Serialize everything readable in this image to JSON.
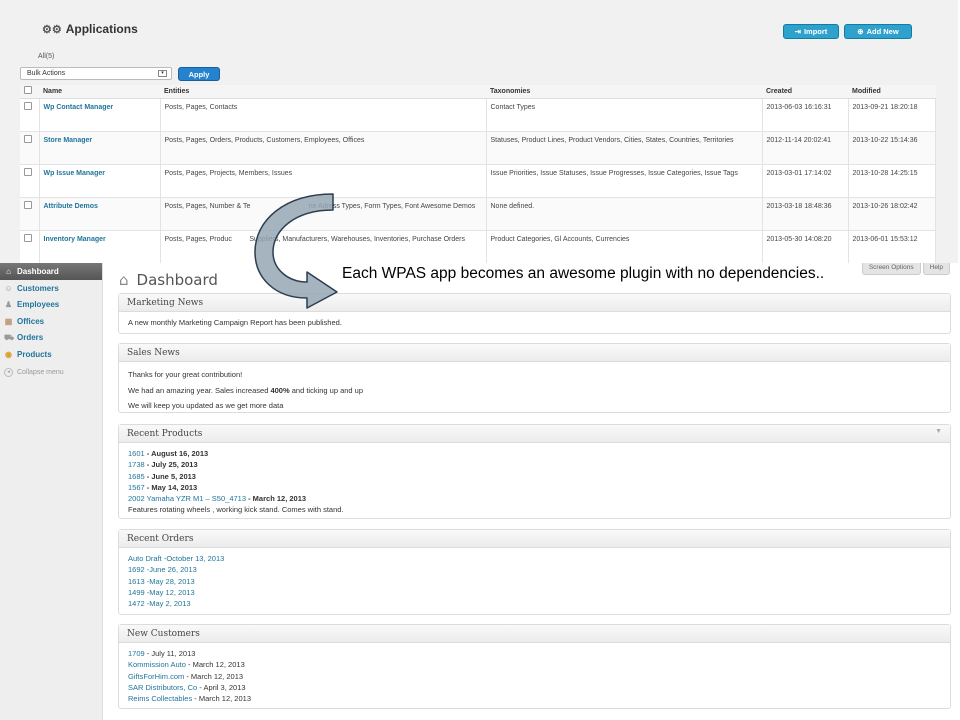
{
  "applications": {
    "title": "Applications",
    "import_label": "Import",
    "add_new_label": "Add New",
    "filter_all": "All(5)",
    "bulk_actions": "Bulk Actions",
    "apply_label": "Apply",
    "columns": [
      "Name",
      "Entities",
      "Taxonomies",
      "Created",
      "Modified"
    ],
    "rows": [
      {
        "name": "Wp Contact Manager",
        "entities": "Posts, Pages, Contacts",
        "taxonomies": "Contact Types",
        "created": "2013-06-03 16:16:31",
        "modified": "2013-09-21 18:20:18"
      },
      {
        "name": "Store Manager",
        "entities": "Posts, Pages, Orders, Products, Customers, Employees, Offices",
        "taxonomies": "Statuses, Product Lines, Product Vendors, Cities, States, Countries, Territories",
        "created": "2012-11-14 20:02:41",
        "modified": "2013-10-22 15:14:36"
      },
      {
        "name": "Wp Issue Manager",
        "entities": "Posts, Pages, Projects, Members, Issues",
        "taxonomies": "Issue Priorities, Issue Statuses, Issue Progresses, Issue Categories, Issue Tags",
        "created": "2013-03-01 17:14:02",
        "modified": "2013-10-28 14:25:15"
      },
      {
        "name": "Attribute Demos",
        "entities": "Posts, Pages, Number & Te                              ne Adress Types, Form Types, Font Awesome Demos",
        "taxonomies": "None defined.",
        "created": "2013-03-18 18:48:36",
        "modified": "2013-10-26 18:02:42"
      },
      {
        "name": "Inventory Manager",
        "entities": "Posts, Pages, Produc         Suppliers, Manufacturers, Warehouses, Inventories, Purchase Orders",
        "taxonomies": "Product Categories, Gl Accounts, Currencies",
        "created": "2013-05-30 14:08:20",
        "modified": "2013-06-01 15:53:12"
      }
    ]
  },
  "sidebar": {
    "items": [
      {
        "label": "Dashboard",
        "icon": "home-icon"
      },
      {
        "label": "Customers",
        "icon": "users-icon"
      },
      {
        "label": "Employees",
        "icon": "group-icon"
      },
      {
        "label": "Offices",
        "icon": "building-icon"
      },
      {
        "label": "Orders",
        "icon": "cart-icon"
      },
      {
        "label": "Products",
        "icon": "box-icon"
      },
      {
        "label": "Collapse menu",
        "icon": "collapse-icon"
      }
    ]
  },
  "dashboard": {
    "title": "Dashboard",
    "screen_options": "Screen Options",
    "help": "Help",
    "marketing": {
      "title": "Marketing News",
      "text": "A new monthly Marketing Campaign Report has been published."
    },
    "sales": {
      "title": "Sales News",
      "line1": "Thanks for your great contribution!",
      "line2_pre": "We had an amazing year. Sales increased ",
      "line2_bold": "400%",
      "line2_post": " and ticking up and up",
      "line3": "We will keep you updated as we get more data"
    },
    "recent_products": {
      "title": "Recent Products",
      "items": [
        {
          "link": "1601",
          "date": " - August 16, 2013"
        },
        {
          "link": "1738",
          "date": " - July 25, 2013"
        },
        {
          "link": "1685",
          "date": " - June 5, 2013"
        },
        {
          "link": "1567",
          "date": " - May 14, 2013"
        },
        {
          "link": "2002 Yamaha YZR M1 – S50_4713",
          "date": " - March 12, 2013"
        }
      ],
      "note": "Features rotating wheels , working kick stand. Comes with stand."
    },
    "recent_orders": {
      "title": "Recent Orders",
      "items": [
        "Auto Draft -October 13, 2013",
        "1692 -June 26, 2013",
        "1613 -May 28, 2013",
        "1499 -May 12, 2013",
        "1472 -May 2, 2013"
      ]
    },
    "new_customers": {
      "title": "New Customers",
      "items": [
        {
          "link": "1709",
          "date": " - July 11, 2013"
        },
        {
          "link": "Kommission Auto",
          "date": " - March 12, 2013"
        },
        {
          "link": "GiftsForHim.com",
          "date": " - March 12, 2013"
        },
        {
          "link": "SAR Distributors, Co",
          "date": " - April 3, 2013"
        },
        {
          "link": "Reims Collectables",
          "date": " - March 12, 2013"
        }
      ]
    }
  },
  "callout": "Each WPAS app becomes an awesome plugin with no dependencies.."
}
